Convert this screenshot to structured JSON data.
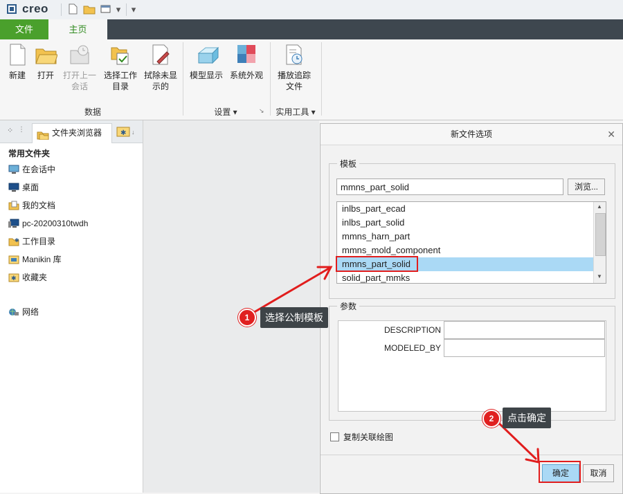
{
  "app": {
    "logo_text": "creo"
  },
  "quick_access": {
    "icons": [
      "new-file-icon",
      "open-folder-icon",
      "window-icon",
      "dropdown-icon",
      "customize-icon"
    ]
  },
  "ribbon_tabs": {
    "file": "文件",
    "home": "主页"
  },
  "ribbon": {
    "new": "新建",
    "open": "打开",
    "open_last_line1": "打开上一",
    "open_last_line2": "会话",
    "select_workdir_line1": "选择工作",
    "select_workdir_line2": "目录",
    "erase_line1": "拭除未显",
    "erase_line2": "示的",
    "model_display": "模型显示",
    "system_appearance": "系统外观",
    "playback_line1": "播放追踪",
    "playback_line2": "文件",
    "group_data": "数据",
    "group_settings": "设置",
    "group_utilities": "实用工具"
  },
  "left_panel": {
    "tab_browser": "文件夹浏览器",
    "common_folders": "常用文件夹",
    "items": [
      "在会话中",
      "桌面",
      "我的文档",
      "pc-20200310twdh",
      "工作目录",
      "Manikin 库",
      "收藏夹"
    ],
    "network": "网络"
  },
  "dialog": {
    "title": "新文件选项",
    "template_label": "模板",
    "template_value": "mmns_part_solid",
    "browse_button": "浏览...",
    "templates": [
      "inlbs_part_ecad",
      "inlbs_part_solid",
      "mmns_harn_part",
      "mmns_mold_component",
      "mmns_part_solid",
      "solid_part_mmks"
    ],
    "selected_index": 4,
    "params_label": "参数",
    "param_names": [
      "DESCRIPTION",
      "MODELED_BY"
    ],
    "copy_drawing_label": "复制关联绘图",
    "ok_button": "确定",
    "cancel_button": "取消"
  },
  "annotations": {
    "step1_number": "1",
    "step1_label": "选择公制模板",
    "step2_number": "2",
    "step2_label": "点击确定"
  },
  "colors": {
    "file_tab": "#4aa02c",
    "home_tab_text": "#2f8a1e",
    "selection": "#aad9f5",
    "annotation_red": "#e11d1d"
  }
}
